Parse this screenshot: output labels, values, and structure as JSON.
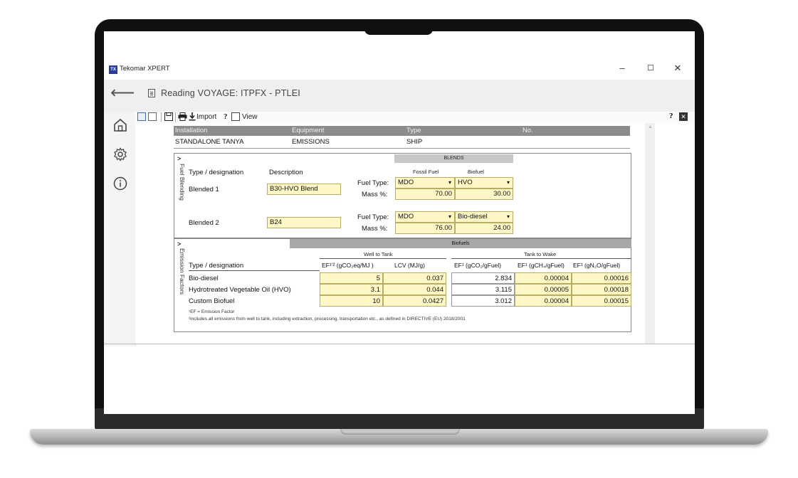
{
  "app": {
    "logo_text": "TX",
    "window_title": "Tekomar XPERT",
    "minimize": "–",
    "maximize": "☐",
    "close": "✕"
  },
  "header": {
    "back": "⟵",
    "reading_title": "Reading VOYAGE: ITPFX - PTLEI"
  },
  "toolbar": {
    "import_label": "Import",
    "help": "?",
    "view_label": "View",
    "help_right": "?",
    "close_right": "✕"
  },
  "installation": {
    "headers": [
      "Installation",
      "Equipment",
      "Type",
      "No."
    ],
    "values": [
      "STANDALONE TANYA",
      "EMISSIONS",
      "SHIP",
      ""
    ]
  },
  "fuel_blending": {
    "tab_label": "Fuel Blending",
    "chevron": ">",
    "col_type": "Type / designation",
    "col_description": "Description",
    "blends_header": "BLENDS",
    "fossil_header": "Fossil Fuel",
    "biofuel_header": "Biofuel",
    "fuel_type_label": "Fuel Type:",
    "mass_label": "Mass %:",
    "rows": [
      {
        "name": "Blended 1",
        "description": "B30-HVO Blend",
        "fossil_type": "MDO",
        "bio_type": "HVO",
        "fossil_mass": "70.00",
        "bio_mass": "30.00"
      },
      {
        "name": "Blended 2",
        "description": "B24",
        "fossil_type": "MDO",
        "bio_type": "Bio-diesel",
        "fossil_mass": "76.00",
        "bio_mass": "24.00"
      }
    ]
  },
  "emission_factors": {
    "tab_label": "Emission Factors",
    "chevron": ">",
    "biofuels_header": "Biofuels",
    "well_to_tank": "Well to Tank",
    "tank_to_wake": "Tank to Wake",
    "col_type": "Type / designation",
    "col_ef_wtt": "EF¹ʼ² (gCO₂eq/MJ )",
    "col_lcv": "LCV (MJ/g)",
    "col_ef_co2": "EF¹ (gCO₂/gFuel)",
    "col_ef_ch4": "EF¹ (gCH₄/gFuel)",
    "col_ef_n2o": "EF¹ (gN₂O/gFuel)",
    "rows": [
      {
        "name": "Bio-diesel",
        "ef_wtt": "5",
        "lcv": "0.037",
        "co2": "2.834",
        "ch4": "0.00004",
        "n2o": "0.00016"
      },
      {
        "name": "Hydrotreated Vegetable Oil (HVO)",
        "ef_wtt": "3.1",
        "lcv": "0.044",
        "co2": "3.115",
        "ch4": "0.00005",
        "n2o": "0.00018"
      },
      {
        "name": "Custom Biofuel",
        "ef_wtt": "10",
        "lcv": "0.0427",
        "co2": "3.012",
        "ch4": "0.00004",
        "n2o": "0.00015"
      }
    ],
    "footnote1": "¹EF = Emission Factor",
    "footnote2": "²includes all emissions from well to tank, including extraction, processing, transportation etc., as defined in DIRECTIVE (EU) 2018/2001"
  }
}
